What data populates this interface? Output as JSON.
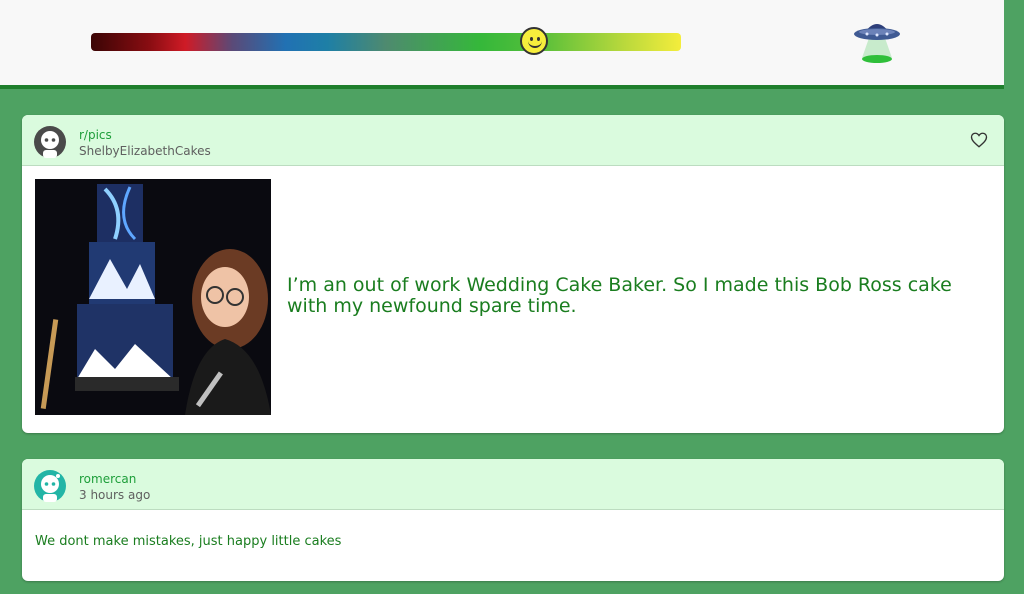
{
  "header": {
    "mood_level": 0.75,
    "mood_icon": "smiley-face-icon",
    "logo_icon": "ufo-icon"
  },
  "post": {
    "subreddit": "r/pics",
    "author": "ShelbyElizabethCakes",
    "title": "I’m an out of work Wedding Cake Baker. So I made this Bob Ross cake with my newfound spare time.",
    "image_description": "woman-with-painted-cake",
    "favorite_icon": "heart-icon"
  },
  "comment": {
    "author": "romercan",
    "time": "3 hours ago",
    "text": "We dont make mistakes, just happy little cakes"
  },
  "colors": {
    "background": "#4ea262",
    "card_header": "#dafbde",
    "accent": "#1a7d1f",
    "header_border": "#1f7f2c"
  }
}
